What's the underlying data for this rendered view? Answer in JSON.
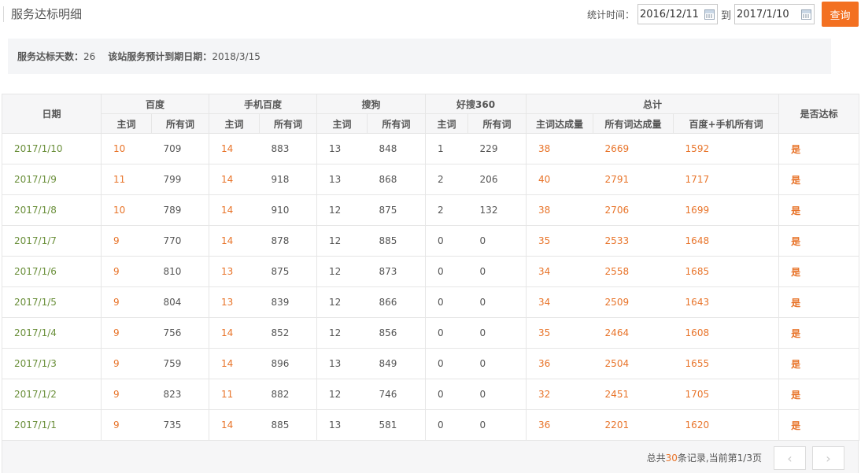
{
  "header": {
    "title": "服务达标明细",
    "query_label": "统计时间：",
    "start_date": "2016/12/11",
    "separator": "到",
    "end_date": "2017/1/10",
    "query_button": "查询"
  },
  "summary": {
    "days_label": "服务达标天数：",
    "days_value": "26",
    "expiry_label": "该站服务预计到期日期：",
    "expiry_value": "2018/3/15"
  },
  "table": {
    "headers": {
      "date": "日期",
      "baidu": "百度",
      "mobile_baidu": "手机百度",
      "sogou": "搜狗",
      "haosou": "好搜360",
      "total": "总计",
      "qualified": "是否达标",
      "main_word": "主词",
      "all_words": "所有词",
      "main_reached": "主词达成量",
      "all_reached": "所有词达成量",
      "baidu_plus_mobile": "百度+手机所有词"
    },
    "rows": [
      [
        "2017/1/10",
        "10",
        "709",
        "14",
        "883",
        "13",
        "848",
        "1",
        "229",
        "38",
        "2669",
        "1592",
        "是"
      ],
      [
        "2017/1/9",
        "11",
        "799",
        "14",
        "918",
        "13",
        "868",
        "2",
        "206",
        "40",
        "2791",
        "1717",
        "是"
      ],
      [
        "2017/1/8",
        "10",
        "789",
        "14",
        "910",
        "12",
        "875",
        "2",
        "132",
        "38",
        "2706",
        "1699",
        "是"
      ],
      [
        "2017/1/7",
        "9",
        "770",
        "14",
        "878",
        "12",
        "885",
        "0",
        "0",
        "35",
        "2533",
        "1648",
        "是"
      ],
      [
        "2017/1/6",
        "9",
        "810",
        "13",
        "875",
        "12",
        "873",
        "0",
        "0",
        "34",
        "2558",
        "1685",
        "是"
      ],
      [
        "2017/1/5",
        "9",
        "804",
        "13",
        "839",
        "12",
        "866",
        "0",
        "0",
        "34",
        "2509",
        "1643",
        "是"
      ],
      [
        "2017/1/4",
        "9",
        "756",
        "14",
        "852",
        "12",
        "856",
        "0",
        "0",
        "35",
        "2464",
        "1608",
        "是"
      ],
      [
        "2017/1/3",
        "9",
        "759",
        "14",
        "896",
        "13",
        "849",
        "0",
        "0",
        "36",
        "2504",
        "1655",
        "是"
      ],
      [
        "2017/1/2",
        "9",
        "823",
        "11",
        "882",
        "12",
        "746",
        "0",
        "0",
        "32",
        "2451",
        "1705",
        "是"
      ],
      [
        "2017/1/1",
        "9",
        "735",
        "14",
        "885",
        "13",
        "581",
        "0",
        "0",
        "36",
        "2201",
        "1620",
        "是"
      ]
    ]
  },
  "pagination": {
    "prefix": "总共",
    "total": "30",
    "suffix": "条记录,当前第1/3页",
    "prev_icon": "chevron-left-icon",
    "next_icon": "chevron-right-icon",
    "prev_glyph": "‹",
    "next_glyph": "›"
  },
  "colors": {
    "accent": "#f37021",
    "date_text": "#6a8f3a",
    "highlight": "#e8742a"
  }
}
